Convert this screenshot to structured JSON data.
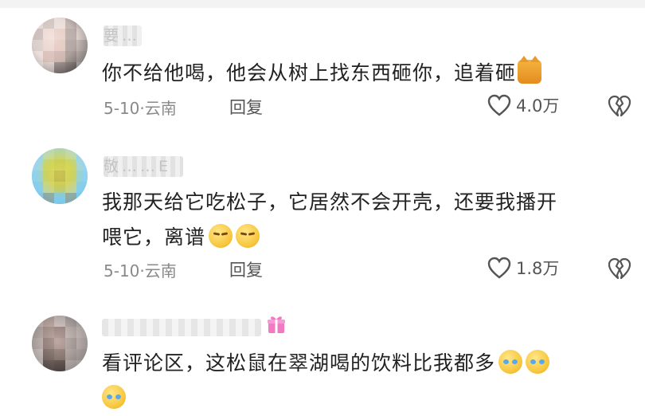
{
  "comments": [
    {
      "username": "要…",
      "text": "你不给他喝，他会从树上找东西砸你，追着砸",
      "date": "5-10",
      "location": "云南",
      "reply_label": "回复",
      "likes": "4.0万",
      "emoji": [
        "cat-emoji"
      ]
    },
    {
      "username": "敬……E",
      "text_line1": "我那天给它吃松子，它居然不会开壳，还要我播开",
      "text_line2": "喂它，离谱",
      "date": "5-10",
      "location": "云南",
      "reply_label": "回复",
      "likes": "1.8万",
      "emoji": [
        "smirk-emoji",
        "smirk-emoji"
      ]
    },
    {
      "username": "",
      "text": "看评论区，这松鼠在翠湖喝的饮料比我都多",
      "emoji": [
        "crying-laughing-emoji",
        "crying-laughing-emoji",
        "crying-laughing-emoji"
      ]
    }
  ],
  "meta_separator": "·"
}
